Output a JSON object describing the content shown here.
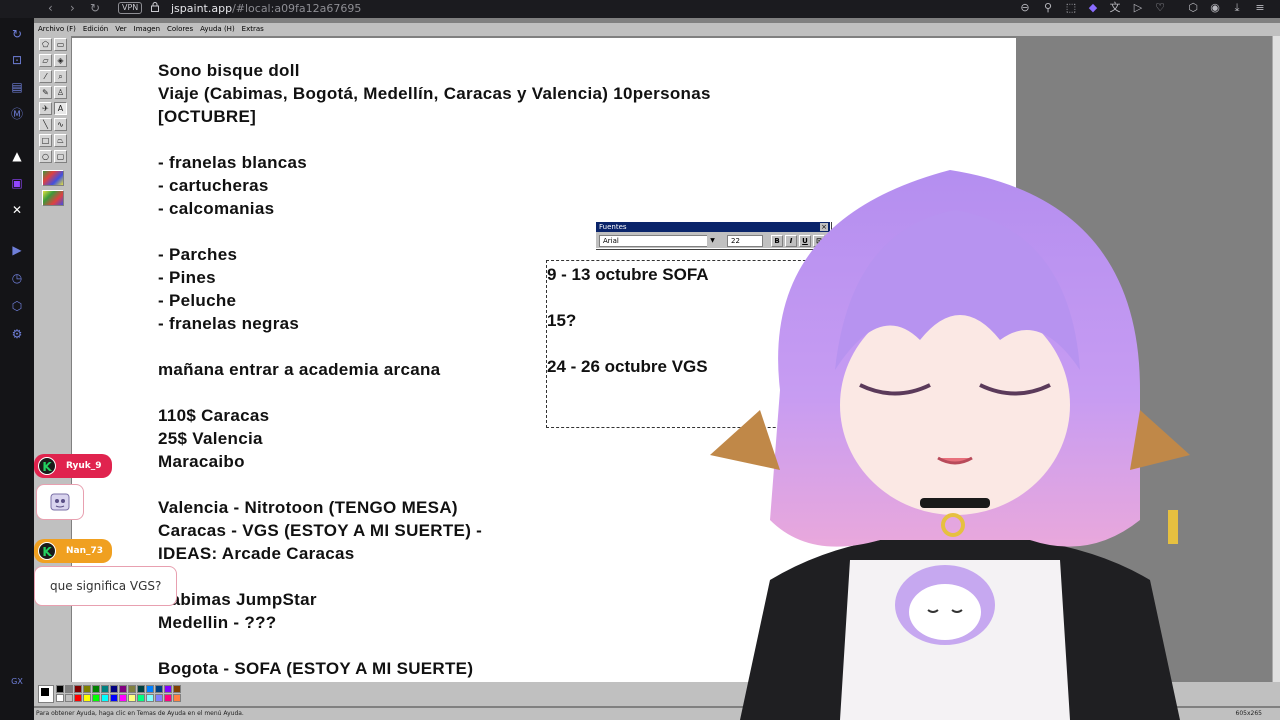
{
  "browser": {
    "vpn": "VPN",
    "url_host": "jspaint.app",
    "url_path": "/#local:a09fa12a67695"
  },
  "menu": [
    "Archivo (F)",
    "Edición",
    "Ver",
    "Imagen",
    "Colores",
    "Ayuda (H)",
    "Extras"
  ],
  "canvas_lines": [
    "Sono bisque doll",
    "Viaje (Cabimas, Bogotá, Medellín, Caracas y Valencia) 10personas",
    "[OCTUBRE]",
    "",
    "- franelas blancas",
    "- cartucheras",
    "- calcomanias",
    "",
    "- Parches",
    "- Pines",
    "- Peluche",
    "- franelas negras",
    "",
    "mañana entrar a academia arcana",
    "",
    "110$ Caracas",
    "25$ Valencia",
    "Maracaibo",
    "",
    "Valencia - Nitrotoon (TENGO MESA)",
    "Caracas - VGS (ESTOY A MI SUERTE) -",
    "IDEAS: Arcade Caracas",
    "",
    "Cabimas JumpStar",
    "Medellin - ???",
    "",
    "Bogota - SOFA (ESTOY A MI SUERTE)"
  ],
  "textbox": {
    "line1": "9 - 13 octubre SOFA",
    "line2": "15?",
    "line3": "24 - 26 octubre VGS"
  },
  "fonts_dialog": {
    "title": "Fuentes",
    "close": "×",
    "font": "Arial",
    "size": "22",
    "bold": "B",
    "italic": "I",
    "underline": "U"
  },
  "chat": [
    {
      "user": "Ryuk_9",
      "message": "",
      "color": "#e0234e"
    },
    {
      "user": "Nan_73",
      "message": "que significa VGS?",
      "color": "#f0a020"
    }
  ],
  "statusbar": {
    "help": "Para obtener Ayuda, haga clic en Temas de Ayuda en el menú Ayuda.",
    "size": "605x265"
  },
  "sidebar_icons": [
    "refresh-icon",
    "shop-icon",
    "wallet-icon",
    "messenger-icon",
    "arc-icon",
    "twitch-icon",
    "x-icon",
    "play-icon",
    "history-icon",
    "extensions-icon",
    "settings-icon",
    "gx-icon"
  ],
  "palette": [
    "#000000",
    "#808080",
    "#800000",
    "#808000",
    "#008000",
    "#008080",
    "#000080",
    "#800080",
    "#808040",
    "#004040",
    "#0080ff",
    "#004080",
    "#8000ff",
    "#804000",
    "#ffffff",
    "#c0c0c0",
    "#ff0000",
    "#ffff00",
    "#00ff00",
    "#00ffff",
    "#0000ff",
    "#ff00ff",
    "#ffff80",
    "#00ff80",
    "#80ffff",
    "#8080ff",
    "#ff0080",
    "#ff8040"
  ]
}
